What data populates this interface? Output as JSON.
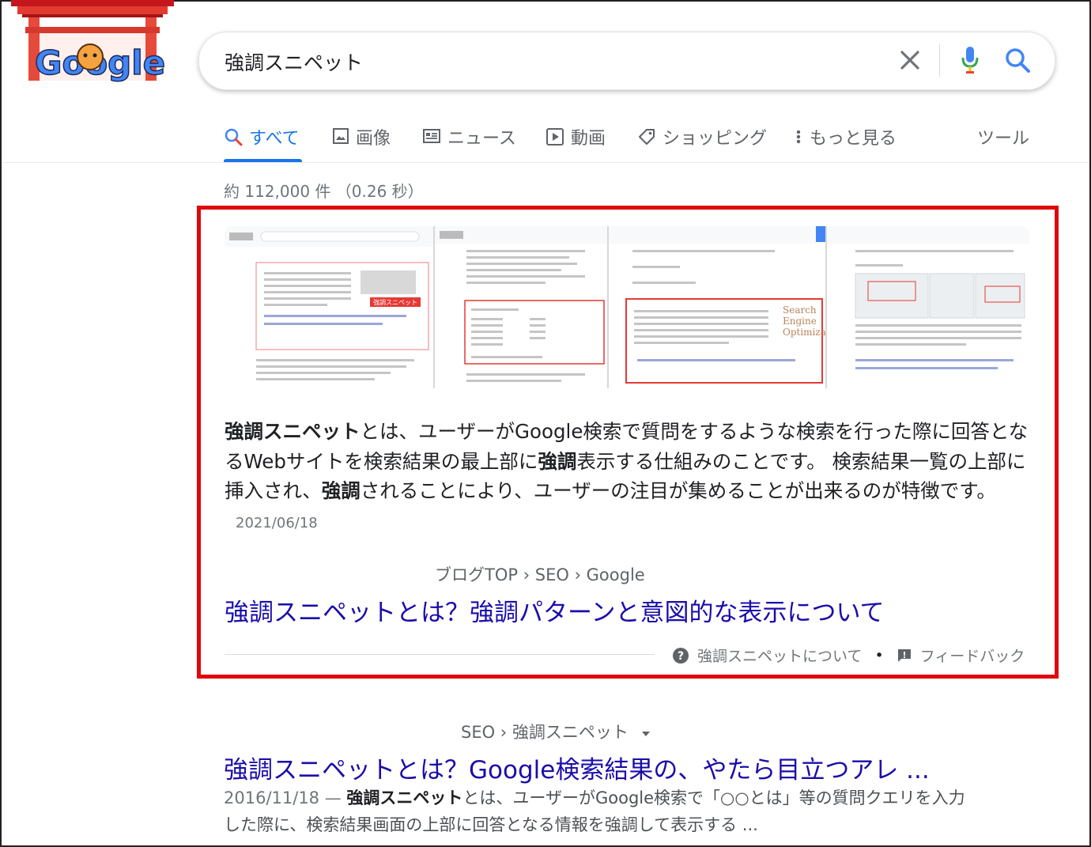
{
  "logo": {
    "text": "Google"
  },
  "search": {
    "query": "強調スニペット"
  },
  "tabs": [
    {
      "label": "すべて",
      "icon": "search-icon",
      "active": true
    },
    {
      "label": "画像",
      "icon": "image-icon"
    },
    {
      "label": "ニュース",
      "icon": "news-icon"
    },
    {
      "label": "動画",
      "icon": "video-icon"
    },
    {
      "label": "ショッピング",
      "icon": "tag-icon"
    },
    {
      "label": "もっと見る",
      "icon": "more-vert-icon"
    }
  ],
  "tools_label": "ツール",
  "result_stats": "約 112,000 件 （0.26 秒）",
  "snippet": {
    "thumb_labels": {
      "search_mini": "Search",
      "engine_mini": "Engine",
      "optimization_mini": "Optimizati",
      "button_mini": "強調スニペット"
    },
    "bold1": "強調スニペット",
    "text1": "とは、ユーザーがGoogle検索で質問をするような検索を行った際に回答となるWebサイトを検索結果の最上部に",
    "bold2": "強調",
    "text2": "表示する仕組みのことです。 検索結果一覧の上部に挿入され、",
    "bold3": "強調",
    "text3": "されることにより、ユーザーの注目が集めることが出来るのが特徴です。",
    "date": "2021/06/18",
    "breadcrumb": "ブログTOP › SEO › Google",
    "title": "強調スニペットとは？強調パターンと意図的な表示について",
    "about_label": "強調スニペットについて",
    "separator": "•",
    "feedback_label": "フィードバック"
  },
  "result2": {
    "breadcrumb": "SEO › 強調スニペット",
    "title": "強調スニペットとは？Google検索結果の、やたら目立つアレ ...",
    "date": "2016/11/18 —",
    "bold": "強調スニペット",
    "text": "とは、ユーザーがGoogle検索で「○○とは」等の質問クエリを入力した際に、検索結果画面の上部に回答となる情報を強調して表示する ..."
  },
  "colors": {
    "accent": "#1a73e8",
    "link": "#1a0dab",
    "highlight_border": "#e0060b"
  }
}
